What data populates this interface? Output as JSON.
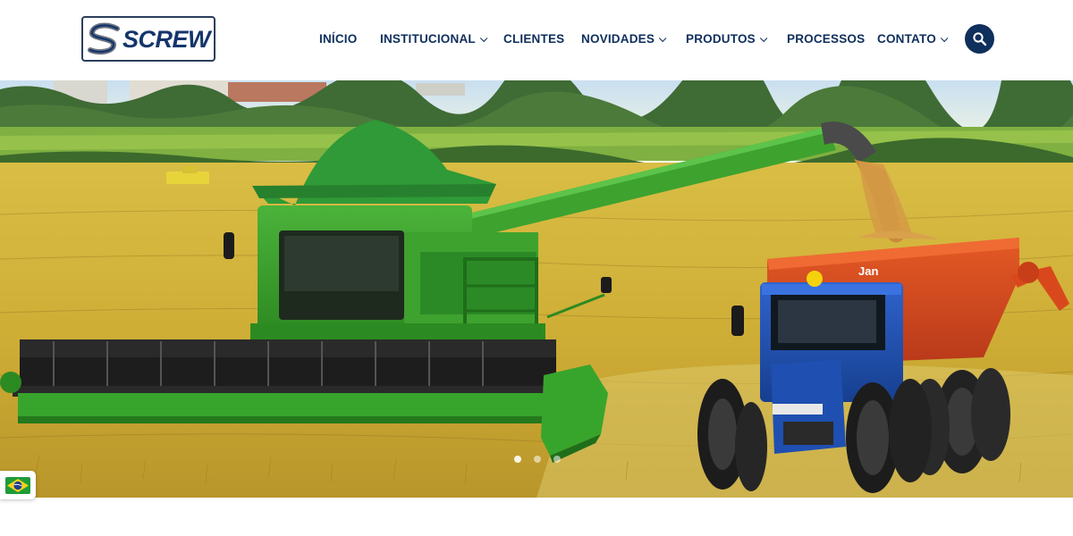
{
  "logo": {
    "text": "SCREW"
  },
  "nav": {
    "items": [
      {
        "label": "INÍCIO",
        "dropdown": false
      },
      {
        "label": "INSTITUCIONAL",
        "dropdown": true
      },
      {
        "label": "CLIENTES",
        "dropdown": false
      },
      {
        "label": "NOVIDADES",
        "dropdown": true
      },
      {
        "label": "PRODUTOS",
        "dropdown": true
      },
      {
        "label": "PROCESSOS",
        "dropdown": false
      },
      {
        "label": "CONTATO",
        "dropdown": true
      }
    ],
    "search_icon": "search-icon"
  },
  "hero": {
    "slider_dot_count": 3,
    "active_slide": 1
  },
  "language": {
    "icon": "brazil-flag-icon"
  },
  "colors": {
    "brand_navy": "#0f2f5c",
    "harvester_green": "#3a9b2e",
    "tractor_blue": "#1f4fb0",
    "cart_orange": "#d9481d",
    "field_gold": "#d6b63a"
  }
}
